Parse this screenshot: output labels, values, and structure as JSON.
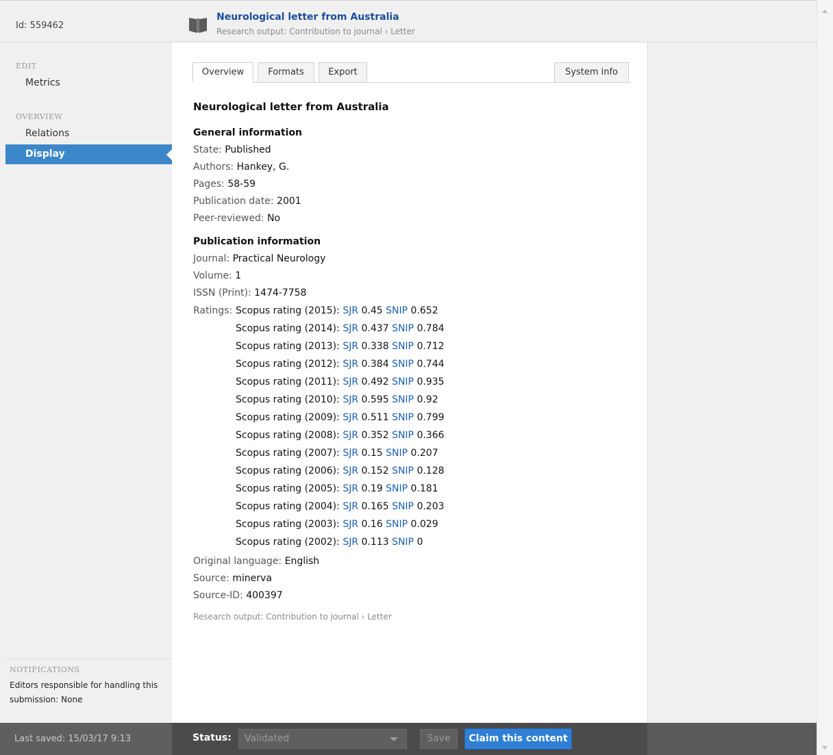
{
  "header": {
    "id_text": "Id: 559462",
    "title": "Neurological letter from Australia",
    "subtitle": "Research output: Contribution to journal › Letter",
    "icon": "book-icon"
  },
  "sidebar": {
    "edit_section": "EDIT",
    "edit_items": [
      {
        "label": "Metrics"
      }
    ],
    "overview_section": "OVERVIEW",
    "overview_items": [
      {
        "label": "Relations"
      },
      {
        "label": "Display"
      }
    ],
    "active_item": "Display",
    "active_color": "#3b87c9",
    "notifications": {
      "label": "NOTIFICATIONS",
      "text": "Editors responsible for handling this submission: None"
    }
  },
  "tabs": [
    {
      "label": "Overview",
      "active": true
    },
    {
      "label": "Formats"
    },
    {
      "label": "Export"
    },
    {
      "label": "System info"
    }
  ],
  "content": {
    "title": "Neurological letter from Australia",
    "general_heading": "General information",
    "general": [
      {
        "key": "State:",
        "value": "Published"
      },
      {
        "key": "Authors:",
        "value": "Hankey, G."
      },
      {
        "key": "Pages:",
        "value": "58-59"
      },
      {
        "key": "Publication date:",
        "value": "2001"
      },
      {
        "key": "Peer-reviewed:",
        "value": "No"
      }
    ],
    "publication_heading": "Publication information",
    "publication": [
      {
        "key": "Journal:",
        "value": "Practical Neurology"
      },
      {
        "key": "Volume:",
        "value": "1"
      },
      {
        "key": "ISSN (Print):",
        "value": "1474-7758"
      }
    ],
    "ratings_label": "Ratings:",
    "sjr_label": "SJR",
    "snip_label": "SNIP",
    "ratings": [
      {
        "name": "Scopus rating (2015):",
        "sjr": "0.45",
        "snip": "0.652"
      },
      {
        "name": "Scopus rating (2014):",
        "sjr": "0.437",
        "snip": "0.784"
      },
      {
        "name": "Scopus rating (2013):",
        "sjr": "0.338",
        "snip": "0.712"
      },
      {
        "name": "Scopus rating (2012):",
        "sjr": "0.384",
        "snip": "0.744"
      },
      {
        "name": "Scopus rating (2011):",
        "sjr": "0.492",
        "snip": "0.935"
      },
      {
        "name": "Scopus rating (2010):",
        "sjr": "0.595",
        "snip": "0.92"
      },
      {
        "name": "Scopus rating (2009):",
        "sjr": "0.511",
        "snip": "0.799"
      },
      {
        "name": "Scopus rating (2008):",
        "sjr": "0.352",
        "snip": "0.366"
      },
      {
        "name": "Scopus rating (2007):",
        "sjr": "0.15",
        "snip": "0.207"
      },
      {
        "name": "Scopus rating (2006):",
        "sjr": "0.152",
        "snip": "0.128"
      },
      {
        "name": "Scopus rating (2005):",
        "sjr": "0.19",
        "snip": "0.181"
      },
      {
        "name": "Scopus rating (2004):",
        "sjr": "0.165",
        "snip": "0.203"
      },
      {
        "name": "Scopus rating (2003):",
        "sjr": "0.16",
        "snip": "0.029"
      },
      {
        "name": "Scopus rating (2002):",
        "sjr": "0.113",
        "snip": "0"
      }
    ],
    "other": [
      {
        "key": "Original language:",
        "value": "English"
      },
      {
        "key": "Source:",
        "value": "minerva"
      },
      {
        "key": "Source-ID:",
        "value": "400397"
      }
    ],
    "footer_crumb": "Research output: Contribution to journal › Letter",
    "link_color": "#1a5fae"
  },
  "footer": {
    "last_saved": "Last saved: 15/03/17 9:13",
    "status_label": "Status:",
    "status_value": "Validated",
    "save_label": "Save",
    "claim_label": "Claim this content",
    "claim_color": "#2f7fd6"
  }
}
